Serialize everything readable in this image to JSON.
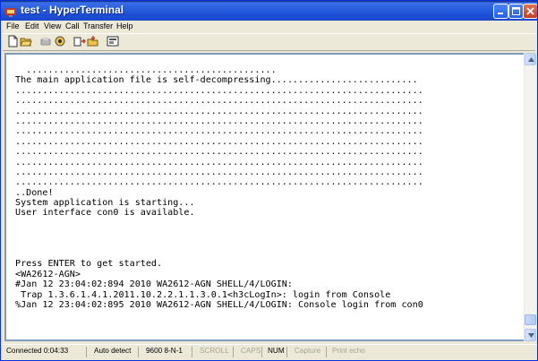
{
  "window": {
    "title": "test - HyperTerminal",
    "title_color": "#1d4fd6"
  },
  "menu": {
    "items": [
      "File",
      "Edit",
      "View",
      "Call",
      "Transfer",
      "Help"
    ]
  },
  "toolbar": {
    "buttons": [
      "new-icon",
      "open-icon",
      "disconnect-icon",
      "dial-icon",
      "send-icon",
      "receive-icon",
      "properties-icon"
    ]
  },
  "terminal": {
    "lines": [
      "  ..............................................",
      "The main application file is self-decompressing...........................",
      "...........................................................................",
      "...........................................................................",
      "...........................................................................",
      "...........................................................................",
      "...........................................................................",
      "...........................................................................",
      "...........................................................................",
      "...........................................................................",
      "...........................................................................",
      "...........................................................................",
      "..Done!",
      "System application is starting...",
      "User interface con0 is available.",
      "",
      "",
      "",
      "",
      "Press ENTER to get started.",
      "<WA2612-AGN>",
      "#Jan 12 23:04:02:894 2010 WA2612-AGN SHELL/4/LOGIN:",
      " Trap 1.3.6.1.4.1.2011.10.2.2.1.1.3.0.1<h3cLogIn>: login from Console",
      "%Jan 12 23:04:02:895 2010 WA2612-AGN SHELL/4/LOGIN: Console login from con0"
    ]
  },
  "status": {
    "connected": "Connected 0:04:33",
    "detect": "Auto detect",
    "settings": "9600 8-N-1",
    "scroll": "SCROLL",
    "caps": "CAPS",
    "num": "NUM",
    "capture": "Capture",
    "print_echo": "Print echo"
  }
}
